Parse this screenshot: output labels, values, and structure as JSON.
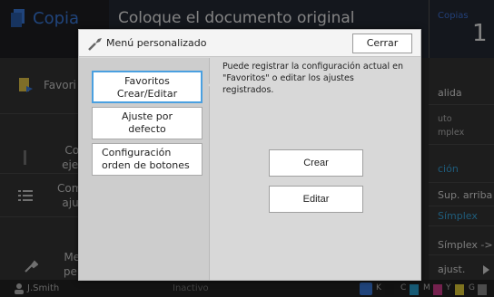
{
  "app": {
    "name": "Copia",
    "background_title": "Coloque el documento original",
    "copies_label": "Copias",
    "copies_value": "1",
    "accent_color": "#3b7de0"
  },
  "left_menu": {
    "items": [
      {
        "label": "Favori",
        "icon": "favorites-icon"
      },
      {
        "label": "Cop\nejem",
        "icon": "copy-sample-icon"
      },
      {
        "label": "Compr\najust",
        "icon": "check-settings-icon"
      },
      {
        "label": "Men\npers",
        "icon": "wrench-icon"
      }
    ]
  },
  "right_panel": {
    "items": [
      {
        "label": "alida"
      },
      {
        "label": "uto\nmplex"
      },
      {
        "label": "ción"
      },
      {
        "label": "Sup. arriba"
      },
      {
        "label": "Símplex"
      },
      {
        "label": "Símplex ->"
      },
      {
        "label": "ajust."
      }
    ]
  },
  "status_bar": {
    "user": "J.Smith",
    "state": "Inactivo",
    "inks": [
      {
        "label": "K",
        "color": "#222222"
      },
      {
        "label": "C",
        "color": "#2aa7d8"
      },
      {
        "label": "M",
        "color": "#d43c8e"
      },
      {
        "label": "Y",
        "color": "#e6d23a"
      },
      {
        "label": "G",
        "color": "#8a8a8a"
      }
    ]
  },
  "dialog": {
    "title": "Menú personalizado",
    "close_label": "Cerrar",
    "menu": [
      {
        "label": "Favoritos\nCrear/Editar",
        "selected": true
      },
      {
        "label": "Ajuste por\ndefecto",
        "selected": false
      },
      {
        "label": "Configuración\norden de botones",
        "selected": false
      }
    ],
    "description": "Puede registrar la configuración actual en \"Favoritos\" o editar los ajustes registrados.",
    "create_label": "Crear",
    "edit_label": "Editar",
    "selection_color": "#4aa0e0"
  }
}
